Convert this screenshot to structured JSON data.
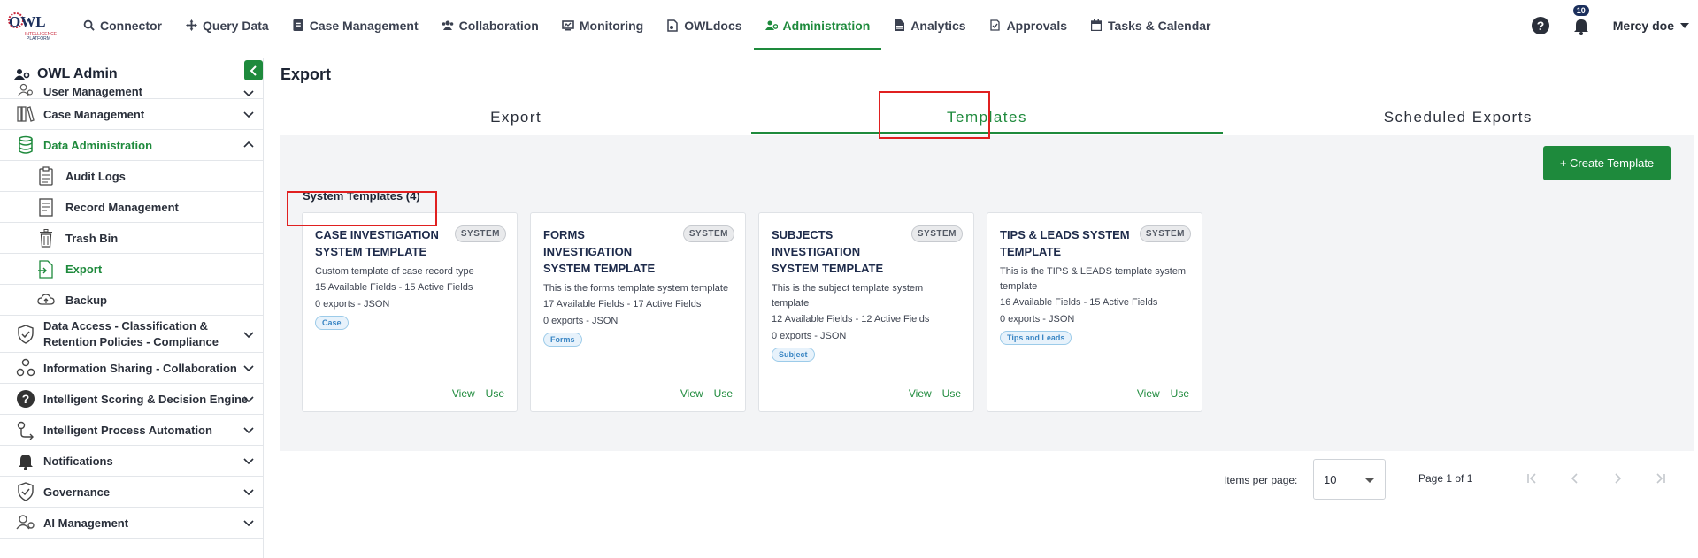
{
  "topnav": {
    "items": [
      {
        "label": "Connector",
        "icon": "search-icon"
      },
      {
        "label": "Query Data",
        "icon": "move-icon"
      },
      {
        "label": "Case Management",
        "icon": "briefcase-icon"
      },
      {
        "label": "Collaboration",
        "icon": "users-icon"
      },
      {
        "label": "Monitoring",
        "icon": "monitor-icon"
      },
      {
        "label": "OWLdocs",
        "icon": "file-icon"
      },
      {
        "label": "Administration",
        "icon": "users-cog-icon",
        "active": true
      },
      {
        "label": "Analytics",
        "icon": "document-icon"
      },
      {
        "label": "Approvals",
        "icon": "approval-icon"
      },
      {
        "label": "Tasks & Calendar",
        "icon": "calendar-icon"
      }
    ],
    "notification_count": "10",
    "user_name": "Mercy doe"
  },
  "sidebar": {
    "title": "OWL Admin",
    "items": [
      {
        "label": "User Management",
        "icon": "user-cog-icon"
      },
      {
        "label": "Case Management",
        "icon": "books-icon"
      },
      {
        "label": "Data Administration",
        "icon": "database-icon",
        "active": true,
        "expanded": true
      },
      {
        "label": "Audit Logs",
        "icon": "clipboard-icon",
        "sub": true
      },
      {
        "label": "Record Management",
        "icon": "record-icon",
        "sub": true
      },
      {
        "label": "Trash Bin",
        "icon": "trash-icon",
        "sub": true
      },
      {
        "label": "Export",
        "icon": "export-icon",
        "sub": true,
        "active": true
      },
      {
        "label": "Backup",
        "icon": "cloud-upload-icon",
        "sub": true
      },
      {
        "label": "Data Access - Classification & Retention Policies - Compliance",
        "icon": "shield-check-icon"
      },
      {
        "label": "Information Sharing - Collaboration",
        "icon": "share-network-icon"
      },
      {
        "label": "Intelligent Scoring & Decision Engine",
        "icon": "question-circle-icon"
      },
      {
        "label": "Intelligent Process Automation",
        "icon": "process-icon"
      },
      {
        "label": "Notifications",
        "icon": "bell-icon"
      },
      {
        "label": "Governance",
        "icon": "governance-shield-icon"
      },
      {
        "label": "AI Management",
        "icon": "ai-cog-icon"
      }
    ]
  },
  "main": {
    "title": "Export",
    "tabs": [
      {
        "label": "Export"
      },
      {
        "label": "Templates",
        "active": true
      },
      {
        "label": "Scheduled Exports"
      }
    ],
    "create_button": "+ Create Template",
    "section_heading": "System Templates (4)",
    "badge_label": "SYSTEM",
    "view_label": "View",
    "use_label": "Use",
    "cards": [
      {
        "title": "CASE INVESTIGATION SYSTEM TEMPLATE",
        "desc": "Custom template of case record type",
        "fields": "15 Available Fields  -  15 Active Fields",
        "exports": "0 exports  -  JSON",
        "tag": "Case"
      },
      {
        "title": "FORMS INVESTIGATION SYSTEM TEMPLATE",
        "desc": "This is the forms template system template",
        "fields": "17 Available Fields  -  17 Active Fields",
        "exports": "0 exports  -  JSON",
        "tag": "Forms"
      },
      {
        "title": "SUBJECTS INVESTIGATION SYSTEM TEMPLATE",
        "desc": "This is the subject template system template",
        "fields": "12 Available Fields  -  12 Active Fields",
        "exports": "0 exports  -  JSON",
        "tag": "Subject"
      },
      {
        "title": "TIPS & LEADS SYSTEM TEMPLATE",
        "desc": "This is the TIPS & LEADS template system template",
        "fields": "16 Available Fields  -  15 Active Fields",
        "exports": "0 exports  -  JSON",
        "tag": "Tips and Leads"
      }
    ],
    "pager": {
      "items_per_page_label": "Items per page:",
      "items_per_page_value": "10",
      "page_label": "Page 1 of 1"
    }
  },
  "colors": {
    "accent": "#1e8a3c",
    "highlight": "#e02020",
    "badge_bg": "#1b2f5c"
  }
}
